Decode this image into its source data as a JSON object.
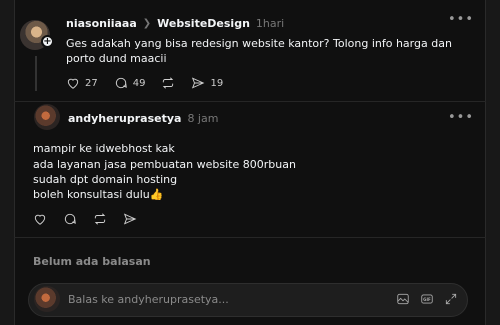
{
  "post": {
    "username": "niasoniiaaa",
    "community": "WebsiteDesign",
    "time": "1hari",
    "text": "Ges adakah yang bisa redesign website kantor? Tolong info harga dan porto dund maacii",
    "likes": "27",
    "comments": "49",
    "shares": "19"
  },
  "reply": {
    "username": "andyheruprasetya",
    "time": "8 jam",
    "lines": [
      "mampir ke idwebhost kak",
      "ada layanan jasa pembuatan website 800rbuan",
      "sudah dpt domain hosting",
      "boleh konsultasi dulu👍"
    ]
  },
  "no_replies_label": "Belum ada balasan",
  "reply_input": {
    "placeholder": "Balas ke andyheruprasetya..."
  },
  "icons": [
    "heart-icon",
    "comment-icon",
    "repost-icon",
    "share-icon",
    "more-icon",
    "image-icon",
    "gif-icon",
    "expand-icon"
  ]
}
